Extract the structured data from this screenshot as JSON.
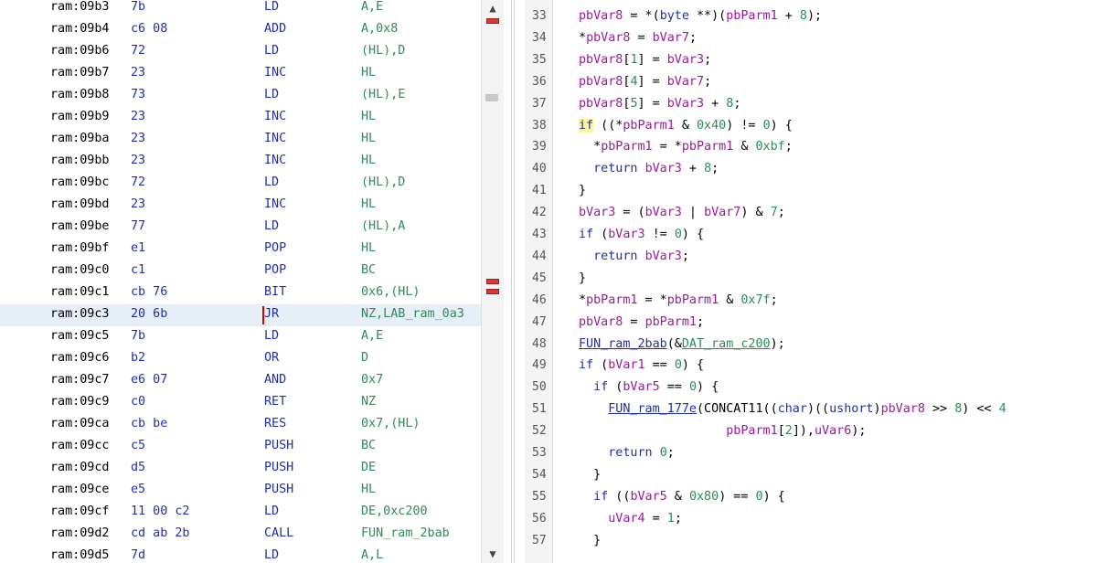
{
  "listing": {
    "rows": [
      {
        "addr": "ram:09b3",
        "bytes": "7b",
        "mnemonic": "LD",
        "operands": "A,E"
      },
      {
        "addr": "ram:09b4",
        "bytes": "c6 08",
        "mnemonic": "ADD",
        "operands": "A,0x8"
      },
      {
        "addr": "ram:09b6",
        "bytes": "72",
        "mnemonic": "LD",
        "operands": "(HL),D"
      },
      {
        "addr": "ram:09b7",
        "bytes": "23",
        "mnemonic": "INC",
        "operands": "HL"
      },
      {
        "addr": "ram:09b8",
        "bytes": "73",
        "mnemonic": "LD",
        "operands": "(HL),E"
      },
      {
        "addr": "ram:09b9",
        "bytes": "23",
        "mnemonic": "INC",
        "operands": "HL"
      },
      {
        "addr": "ram:09ba",
        "bytes": "23",
        "mnemonic": "INC",
        "operands": "HL"
      },
      {
        "addr": "ram:09bb",
        "bytes": "23",
        "mnemonic": "INC",
        "operands": "HL"
      },
      {
        "addr": "ram:09bc",
        "bytes": "72",
        "mnemonic": "LD",
        "operands": "(HL),D"
      },
      {
        "addr": "ram:09bd",
        "bytes": "23",
        "mnemonic": "INC",
        "operands": "HL"
      },
      {
        "addr": "ram:09be",
        "bytes": "77",
        "mnemonic": "LD",
        "operands": "(HL),A"
      },
      {
        "addr": "ram:09bf",
        "bytes": "e1",
        "mnemonic": "POP",
        "operands": "HL"
      },
      {
        "addr": "ram:09c0",
        "bytes": "c1",
        "mnemonic": "POP",
        "operands": "BC"
      },
      {
        "addr": "ram:09c1",
        "bytes": "cb 76",
        "mnemonic": "BIT",
        "operands": "0x6,(HL)"
      },
      {
        "addr": "ram:09c3",
        "bytes": "20 6b",
        "mnemonic": "JR",
        "operands": "NZ,LAB_ram_0a3"
      },
      {
        "addr": "ram:09c5",
        "bytes": "7b",
        "mnemonic": "LD",
        "operands": "A,E"
      },
      {
        "addr": "ram:09c6",
        "bytes": "b2",
        "mnemonic": "OR",
        "operands": "D"
      },
      {
        "addr": "ram:09c7",
        "bytes": "e6 07",
        "mnemonic": "AND",
        "operands": "0x7"
      },
      {
        "addr": "ram:09c9",
        "bytes": "c0",
        "mnemonic": "RET",
        "operands": "NZ"
      },
      {
        "addr": "ram:09ca",
        "bytes": "cb be",
        "mnemonic": "RES",
        "operands": "0x7,(HL)"
      },
      {
        "addr": "ram:09cc",
        "bytes": "c5",
        "mnemonic": "PUSH",
        "operands": "BC"
      },
      {
        "addr": "ram:09cd",
        "bytes": "d5",
        "mnemonic": "PUSH",
        "operands": "DE"
      },
      {
        "addr": "ram:09ce",
        "bytes": "e5",
        "mnemonic": "PUSH",
        "operands": "HL"
      },
      {
        "addr": "ram:09cf",
        "bytes": "11 00 c2",
        "mnemonic": "LD",
        "operands": "DE,0xc200"
      },
      {
        "addr": "ram:09d2",
        "bytes": "cd ab 2b",
        "mnemonic": "CALL",
        "operands": "FUN_ram_2bab"
      },
      {
        "addr": "ram:09d5",
        "bytes": "7d",
        "mnemonic": "LD",
        "operands": "A,L"
      }
    ],
    "selected_addr": "ram:09c3"
  },
  "scrollbar": {
    "up_arrow": "▲",
    "down_arrow": "▼"
  },
  "decompiler": {
    "line_numbers": [
      "33",
      "34",
      "35",
      "36",
      "37",
      "38",
      "39",
      "40",
      "41",
      "42",
      "43",
      "44",
      "45",
      "46",
      "47",
      "48",
      "49",
      "50",
      "51",
      "52",
      "53",
      "54",
      "55",
      "56",
      "57"
    ],
    "lines": [
      [
        [
          "v",
          "pbVar8"
        ],
        [
          "p",
          " = *("
        ],
        [
          "t",
          "byte"
        ],
        [
          "p",
          " **)("
        ],
        [
          "v",
          "pbParm1"
        ],
        [
          "p",
          " + "
        ],
        [
          "n",
          "8"
        ],
        [
          "p",
          ");"
        ]
      ],
      [
        [
          "p",
          "*"
        ],
        [
          "v",
          "pbVar8"
        ],
        [
          "p",
          " = "
        ],
        [
          "v",
          "bVar7"
        ],
        [
          "p",
          ";"
        ]
      ],
      [
        [
          "v",
          "pbVar8"
        ],
        [
          "p",
          "["
        ],
        [
          "n",
          "1"
        ],
        [
          "p",
          "] = "
        ],
        [
          "v",
          "bVar3"
        ],
        [
          "p",
          ";"
        ]
      ],
      [
        [
          "v",
          "pbVar8"
        ],
        [
          "p",
          "["
        ],
        [
          "n",
          "4"
        ],
        [
          "p",
          "] = "
        ],
        [
          "v",
          "bVar7"
        ],
        [
          "p",
          ";"
        ]
      ],
      [
        [
          "v",
          "pbVar8"
        ],
        [
          "p",
          "["
        ],
        [
          "n",
          "5"
        ],
        [
          "p",
          "] = "
        ],
        [
          "v",
          "bVar3"
        ],
        [
          "p",
          " + "
        ],
        [
          "n",
          "8"
        ],
        [
          "p",
          ";"
        ]
      ],
      [
        [
          "h",
          "if"
        ],
        [
          "p",
          " ((*"
        ],
        [
          "v",
          "pbParm1"
        ],
        [
          "p",
          " & "
        ],
        [
          "n",
          "0x40"
        ],
        [
          "p",
          ") != "
        ],
        [
          "n",
          "0"
        ],
        [
          "p",
          ") {"
        ]
      ],
      [
        [
          "p",
          "  *"
        ],
        [
          "v",
          "pbParm1"
        ],
        [
          "p",
          " = *"
        ],
        [
          "v",
          "pbParm1"
        ],
        [
          "p",
          " & "
        ],
        [
          "n",
          "0xbf"
        ],
        [
          "p",
          ";"
        ]
      ],
      [
        [
          "p",
          "  "
        ],
        [
          "k",
          "return"
        ],
        [
          "p",
          " "
        ],
        [
          "v",
          "bVar3"
        ],
        [
          "p",
          " + "
        ],
        [
          "n",
          "8"
        ],
        [
          "p",
          ";"
        ]
      ],
      [
        [
          "p",
          "}"
        ]
      ],
      [
        [
          "v",
          "bVar3"
        ],
        [
          "p",
          " = ("
        ],
        [
          "v",
          "bVar3"
        ],
        [
          "p",
          " | "
        ],
        [
          "v",
          "bVar7"
        ],
        [
          "p",
          ") & "
        ],
        [
          "n",
          "7"
        ],
        [
          "p",
          ";"
        ]
      ],
      [
        [
          "k",
          "if"
        ],
        [
          "p",
          " ("
        ],
        [
          "v",
          "bVar3"
        ],
        [
          "p",
          " != "
        ],
        [
          "n",
          "0"
        ],
        [
          "p",
          ") {"
        ]
      ],
      [
        [
          "p",
          "  "
        ],
        [
          "k",
          "return"
        ],
        [
          "p",
          " "
        ],
        [
          "v",
          "bVar3"
        ],
        [
          "p",
          ";"
        ]
      ],
      [
        [
          "p",
          "}"
        ]
      ],
      [
        [
          "p",
          "*"
        ],
        [
          "v",
          "pbParm1"
        ],
        [
          "p",
          " = *"
        ],
        [
          "v",
          "pbParm1"
        ],
        [
          "p",
          " & "
        ],
        [
          "n",
          "0x7f"
        ],
        [
          "p",
          ";"
        ]
      ],
      [
        [
          "v",
          "pbVar8"
        ],
        [
          "p",
          " = "
        ],
        [
          "v",
          "pbParm1"
        ],
        [
          "p",
          ";"
        ]
      ],
      [
        [
          "f",
          "FUN_ram_2bab"
        ],
        [
          "p",
          "(&"
        ],
        [
          "g",
          "DAT_ram_c200"
        ],
        [
          "p",
          ");"
        ]
      ],
      [
        [
          "k",
          "if"
        ],
        [
          "p",
          " ("
        ],
        [
          "v",
          "bVar1"
        ],
        [
          "p",
          " == "
        ],
        [
          "n",
          "0"
        ],
        [
          "p",
          ") {"
        ]
      ],
      [
        [
          "p",
          "  "
        ],
        [
          "k",
          "if"
        ],
        [
          "p",
          " ("
        ],
        [
          "v",
          "bVar5"
        ],
        [
          "p",
          " == "
        ],
        [
          "n",
          "0"
        ],
        [
          "p",
          ") {"
        ]
      ],
      [
        [
          "p",
          "    "
        ],
        [
          "f",
          "FUN_ram_177e"
        ],
        [
          "p",
          "(CONCAT11(("
        ],
        [
          "t",
          "char"
        ],
        [
          "p",
          ")(("
        ],
        [
          "t",
          "ushort"
        ],
        [
          "p",
          ")"
        ],
        [
          "v",
          "pbVar8"
        ],
        [
          "p",
          " >> "
        ],
        [
          "n",
          "8"
        ],
        [
          "p",
          ") << "
        ],
        [
          "n",
          "4"
        ]
      ],
      [
        [
          "p",
          "                    "
        ],
        [
          "v",
          "pbParm1"
        ],
        [
          "p",
          "["
        ],
        [
          "n",
          "2"
        ],
        [
          "p",
          "]),"
        ],
        [
          "v",
          "uVar6"
        ],
        [
          "p",
          ");"
        ]
      ],
      [
        [
          "p",
          "    "
        ],
        [
          "k",
          "return"
        ],
        [
          "p",
          " "
        ],
        [
          "n",
          "0"
        ],
        [
          "p",
          ";"
        ]
      ],
      [
        [
          "p",
          "  }"
        ]
      ],
      [
        [
          "p",
          "  "
        ],
        [
          "k",
          "if"
        ],
        [
          "p",
          " (("
        ],
        [
          "v",
          "bVar5"
        ],
        [
          "p",
          " & "
        ],
        [
          "n",
          "0x80"
        ],
        [
          "p",
          ") == "
        ],
        [
          "n",
          "0"
        ],
        [
          "p",
          ") {"
        ]
      ],
      [
        [
          "p",
          "    "
        ],
        [
          "v",
          "uVar4"
        ],
        [
          "p",
          " = "
        ],
        [
          "n",
          "1"
        ],
        [
          "p",
          ";"
        ]
      ],
      [
        [
          "p",
          "  }"
        ]
      ]
    ]
  }
}
